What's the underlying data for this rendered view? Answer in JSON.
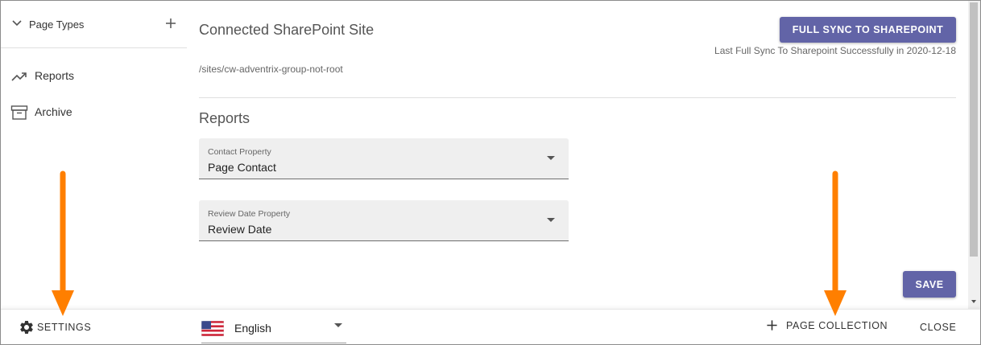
{
  "sidebar": {
    "header_title": "Page Types",
    "items": [
      {
        "label": "Reports",
        "icon": "trending-up-icon"
      },
      {
        "label": "Archive",
        "icon": "archive-icon"
      }
    ]
  },
  "main": {
    "site_title": "Connected SharePoint Site",
    "site_path": "/sites/cw-adventrix-group-not-root",
    "sync_button_label": "FULL SYNC TO SHAREPOINT",
    "sync_status": "Last Full Sync To Sharepoint Successfully in 2020-12-18",
    "section_title": "Reports",
    "contact_select": {
      "label": "Contact Property",
      "value": "Page Contact"
    },
    "review_select": {
      "label": "Review Date Property",
      "value": "Review Date"
    },
    "save_label": "SAVE"
  },
  "footer": {
    "settings_label": "SETTINGS",
    "language": "English",
    "page_collection_label": "PAGE COLLECTION",
    "close_label": "CLOSE"
  },
  "colors": {
    "accent": "#6264a7",
    "annotation": "#ff7f00"
  }
}
